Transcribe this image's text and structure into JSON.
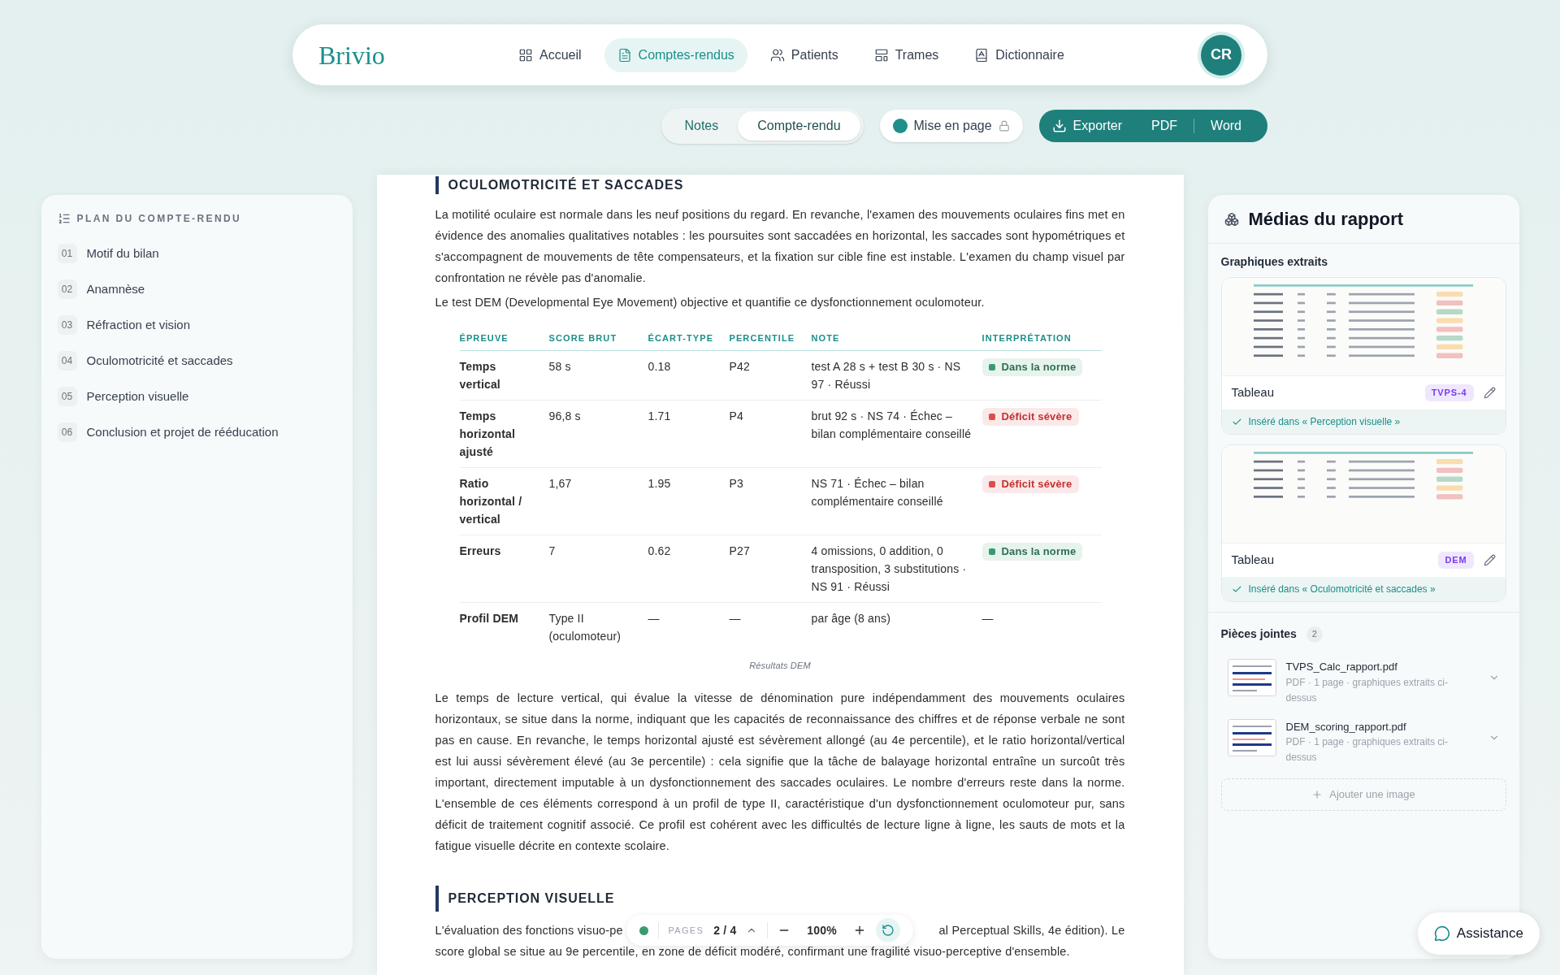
{
  "nav": {
    "logo": "Brivio",
    "items": [
      {
        "label": "Accueil",
        "selected": false
      },
      {
        "label": "Comptes-rendus",
        "selected": true
      },
      {
        "label": "Patients",
        "selected": false
      },
      {
        "label": "Trames",
        "selected": false
      },
      {
        "label": "Dictionnaire",
        "selected": false
      }
    ],
    "avatar": "CR"
  },
  "view_toggle": [
    {
      "label": "Notes",
      "selected": false
    },
    {
      "label": "Compte-rendu",
      "selected": true
    }
  ],
  "layout_toggle": {
    "label": "Mise en page",
    "on": true,
    "locked": true
  },
  "export": {
    "label": "Exporter",
    "formats": [
      "PDF",
      "Word"
    ]
  },
  "outline": {
    "title": "PLAN DU COMPTE-RENDU",
    "items": [
      {
        "number": "01",
        "label": "Motif du bilan"
      },
      {
        "number": "02",
        "label": "Anamnèse"
      },
      {
        "number": "03",
        "label": "Réfraction et vision"
      },
      {
        "number": "04",
        "label": "Oculomotricité et saccades"
      },
      {
        "number": "05",
        "label": "Perception visuelle"
      },
      {
        "number": "06",
        "label": "Conclusion et projet de rééducation"
      }
    ]
  },
  "document": {
    "section_title": "OCULOMOTRICITÉ ET SACCADES",
    "paragraphs": [
      "La motilité oculaire est normale dans les neuf positions du regard. En revanche, l'examen des mouvements oculaires fins met en évidence des anomalies qualitatives notables : les poursuites sont saccadées en horizontal, les saccades sont hypométriques et s'accompagnent de mouvements de tête compensateurs, et la fixation sur cible fine est instable. L'examen du champ visuel par confrontation ne révèle pas d'anomalie.",
      "Le test DEM (Developmental Eye Movement) objective et quantifie ce dysfonctionnement oculomoteur."
    ],
    "table": {
      "columns": [
        "ÉPREUVE",
        "SCORE BRUT",
        "ÉCART-TYPE",
        "PERCENTILE",
        "NOTE",
        "INTERPRÉTATION"
      ],
      "rows": [
        {
          "cells": [
            "Temps vertical",
            "58 s",
            "0.18",
            "P42",
            "test A 28 s + test B 30 s · NS 97 · Réussi"
          ],
          "interpretation": {
            "kind": "badge",
            "label": "Dans la norme",
            "color": "#3a9a6e"
          }
        },
        {
          "cells": [
            "Temps horizontal ajusté",
            "96,8 s",
            "1.71",
            "P4",
            "brut 92 s · NS 74 · Échec – bilan complémentaire conseillé"
          ],
          "interpretation": {
            "kind": "badge",
            "label": "Déficit sévère",
            "color": "#dc4d4d"
          }
        },
        {
          "cells": [
            "Ratio horizontal / vertical",
            "1,67",
            "1.95",
            "P3",
            "NS 71 · Échec – bilan complémentaire conseillé"
          ],
          "interpretation": {
            "kind": "badge",
            "label": "Déficit sévère",
            "color": "#dc4d4d"
          }
        },
        {
          "cells": [
            "Erreurs",
            "7",
            "0.62",
            "P27",
            "4 omissions, 0 addition, 0 transposition, 3 substitutions · NS 91 · Réussi"
          ],
          "interpretation": {
            "kind": "badge",
            "label": "Dans la norme",
            "color": "#3a9a6e"
          }
        },
        {
          "cells": [
            "Profil DEM",
            "Type II (oculomoteur)",
            "—",
            "—",
            "par âge (8 ans)"
          ],
          "interpretation": {
            "kind": "text",
            "label": "—"
          }
        }
      ],
      "caption": "Résultats DEM"
    },
    "analysis": "Le temps de lecture vertical, qui évalue la vitesse de dénomination pure indépendamment des mouvements oculaires horizontaux, se situe dans la norme, indiquant que les capacités de reconnaissance des chiffres et de réponse verbale ne sont pas en cause. En revanche, le temps horizontal ajusté est sévèrement allongé (au 4e percentile), et le ratio horizontal/vertical est lui aussi sévèrement élevé (au 3e percentile) : cela signifie que la tâche de balayage horizontal entraîne un surcoût très important, directement imputable à un dysfonctionnement des saccades oculaires. Le nombre d'erreurs reste dans la norme. L'ensemble de ces éléments correspond à un profil de type II, caractéristique d'un dysfonctionnement oculomoteur pur, sans déficit de traitement cognitif associé. Ce profil est cohérent avec les difficultés de lecture ligne à ligne, les sauts de mots et la fatigue visuelle décrite en contexte scolaire.",
    "next_section_title": "PERCEPTION VISUELLE",
    "next_line_start": "L'évaluation des fonctions visuo-pe",
    "next_line_end": "al Perceptual Skills, 4e édition). Le",
    "next_line_2": "score global se situe au 9e percentile, en zone de déficit modéré, confirmant une fragilité visuo-perceptive d'ensemble."
  },
  "pager": {
    "label": "PAGES",
    "current": "2",
    "separator": "/",
    "total": "4",
    "zoom": "100%"
  },
  "media": {
    "title": "Médias du rapport",
    "charts_title": "Graphiques extraits",
    "charts": [
      {
        "label": "Tableau",
        "tag": "TVPS-4",
        "inserted": "Inséré dans « Perception visuelle »"
      },
      {
        "label": "Tableau",
        "tag": "DEM",
        "inserted": "Inséré dans « Oculomotricité et saccades »"
      }
    ],
    "attachments_title": "Pièces jointes",
    "attachments_count": "2",
    "attachments": [
      {
        "name": "TVPS_Calc_rapport.pdf",
        "meta": "PDF · 1 page · graphiques extraits ci-dessus"
      },
      {
        "name": "DEM_scoring_rapport.pdf",
        "meta": "PDF · 1 page · graphiques extraits ci-dessus"
      }
    ],
    "add_label": "Ajouter une image"
  },
  "assistance": "Assistance"
}
